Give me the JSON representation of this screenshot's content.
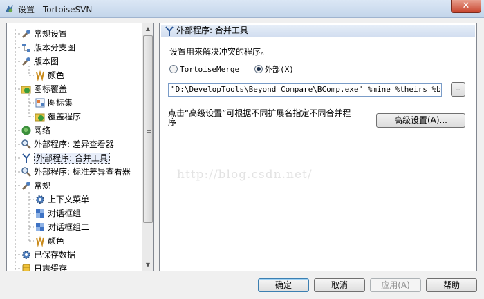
{
  "window": {
    "title": "设置 - TortoiseSVN",
    "close_label": "✕"
  },
  "tree": {
    "items": [
      {
        "label": "常规设置",
        "icon": "wrench-icon"
      },
      {
        "label": "版本分支图",
        "icon": "graph-icon"
      },
      {
        "label": "版本图",
        "icon": "wrench-icon"
      },
      {
        "label": "颜色",
        "icon": "palette-icon"
      },
      {
        "label": "图标覆盖",
        "icon": "overlay-icon"
      },
      {
        "label": "图标集",
        "icon": "iconset-icon"
      },
      {
        "label": "覆盖程序",
        "icon": "overlay-icon"
      },
      {
        "label": "网络",
        "icon": "globe-icon"
      },
      {
        "label": "外部程序: 差异查看器",
        "icon": "magnifier-icon"
      },
      {
        "label": "外部程序: 合并工具",
        "icon": "merge-icon"
      },
      {
        "label": "外部程序: 标准差异查看器",
        "icon": "magnifier-icon"
      },
      {
        "label": "常规",
        "icon": "wrench-icon"
      },
      {
        "label": "上下文菜单",
        "icon": "gear-icon"
      },
      {
        "label": "对话框组一",
        "icon": "puzzle-icon"
      },
      {
        "label": "对话框组二",
        "icon": "puzzle-icon"
      },
      {
        "label": "颜色",
        "icon": "palette-icon"
      },
      {
        "label": "已保存数据",
        "icon": "gear-icon"
      },
      {
        "label": "日志缓存",
        "icon": "database-icon"
      }
    ],
    "selected_index": 9
  },
  "pane": {
    "header": "外部程序: 合并工具",
    "description": "设置用来解决冲突的程序。",
    "radio_tortoise": "TortoiseMerge",
    "radio_external": "外部(X)",
    "selected_option": "external",
    "command_value": "\"D:\\DevelopTools\\Beyond Compare\\BComp.exe\" %mine %theirs %base %m",
    "browse_label": "..",
    "advanced_text": "点击“高级设置”可根据不同扩展名指定不同合并程序",
    "advanced_button": "高级设置(A)..."
  },
  "watermark": "http://blog.csdn.net/",
  "buttons": {
    "ok": "确定",
    "cancel": "取消",
    "apply": "应用(A)",
    "help": "帮助"
  }
}
